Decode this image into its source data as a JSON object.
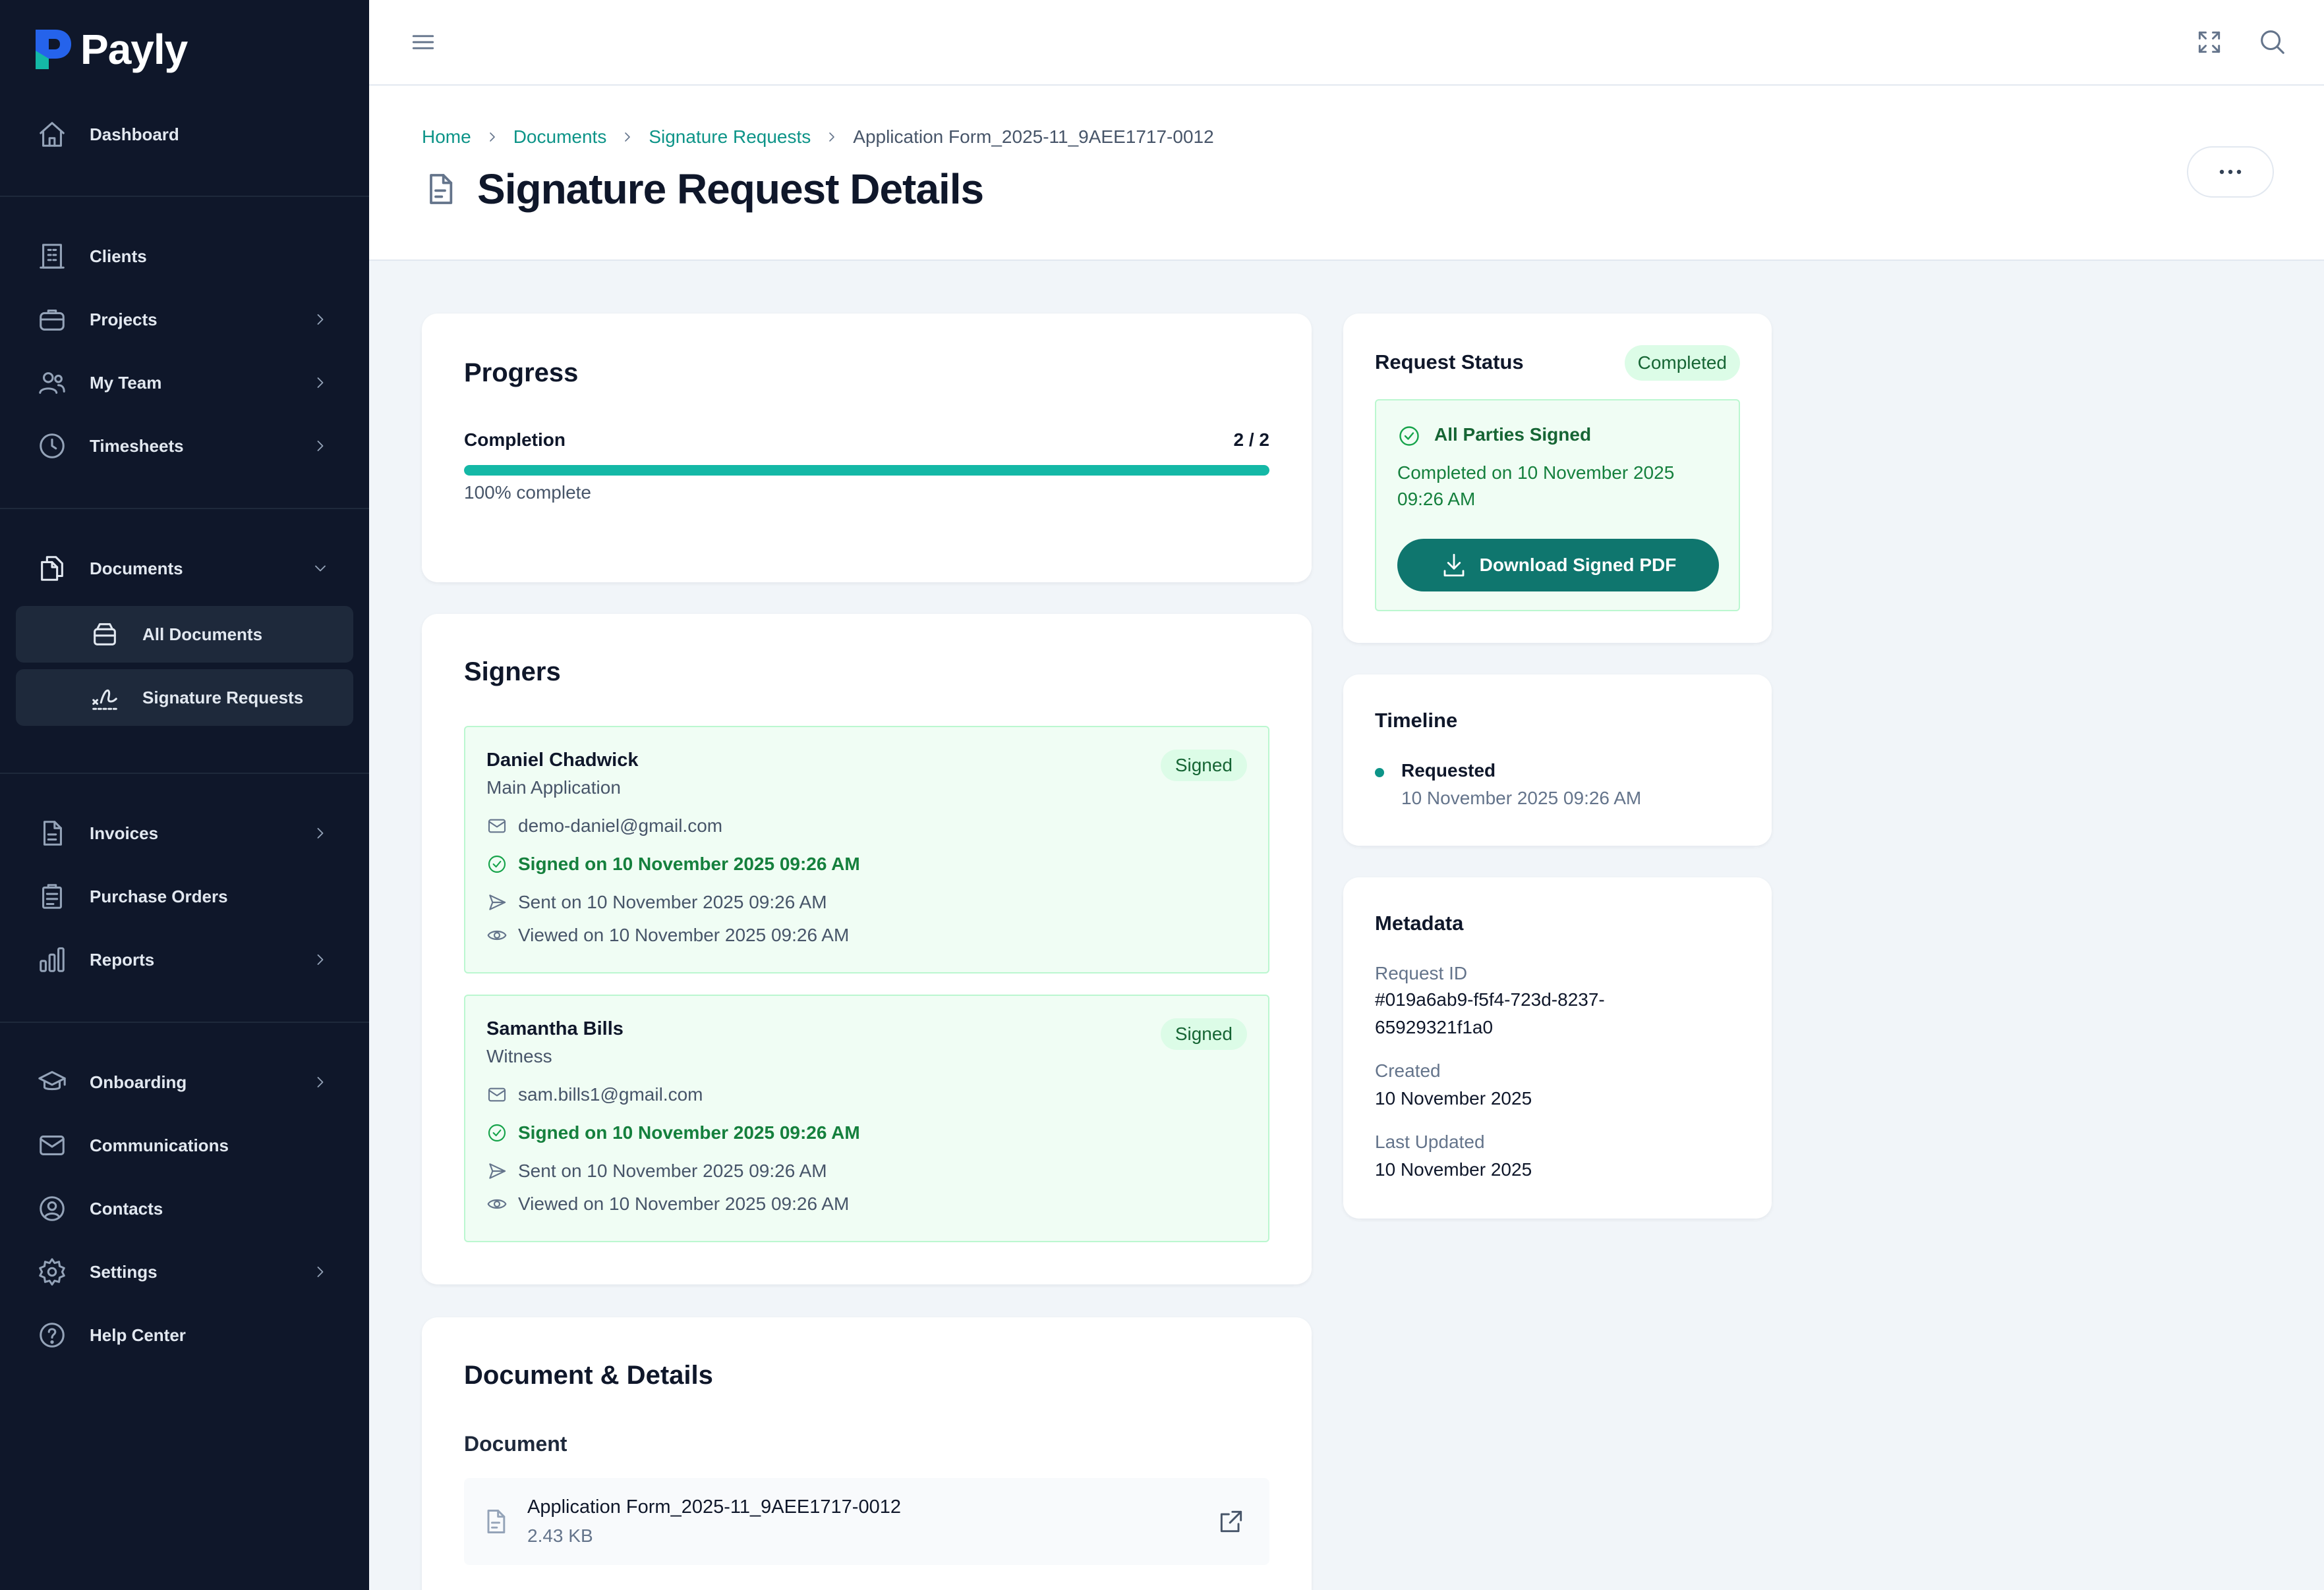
{
  "app": {
    "name": "Payly"
  },
  "sidebar": {
    "dashboard": "Dashboard",
    "clients": "Clients",
    "projects": "Projects",
    "my_team": "My Team",
    "timesheets": "Timesheets",
    "documents": "Documents",
    "all_documents": "All Documents",
    "signature_requests": "Signature Requests",
    "invoices": "Invoices",
    "purchase_orders": "Purchase Orders",
    "reports": "Reports",
    "onboarding": "Onboarding",
    "communications": "Communications",
    "contacts": "Contacts",
    "settings": "Settings",
    "help_center": "Help Center"
  },
  "breadcrumb": {
    "home": "Home",
    "documents": "Documents",
    "signature_requests": "Signature Requests",
    "current": "Application Form_2025-11_9AEE1717-0012"
  },
  "page": {
    "title": "Signature Request Details"
  },
  "progress": {
    "title": "Progress",
    "label": "Completion",
    "count": "2 / 2",
    "percent": 100,
    "percent_text": "100% complete"
  },
  "signers": {
    "title": "Signers",
    "items": [
      {
        "name": "Daniel Chadwick",
        "role": "Main Application",
        "status": "Signed",
        "email": "demo-daniel@gmail.com",
        "signed": "Signed on 10 November 2025 09:26 AM",
        "sent": "Sent on 10 November 2025 09:26 AM",
        "viewed": "Viewed on 10 November 2025 09:26 AM"
      },
      {
        "name": "Samantha Bills",
        "role": "Witness",
        "status": "Signed",
        "email": "sam.bills1@gmail.com",
        "signed": "Signed on 10 November 2025 09:26 AM",
        "sent": "Sent on 10 November 2025 09:26 AM",
        "viewed": "Viewed on 10 November 2025 09:26 AM"
      }
    ]
  },
  "document": {
    "title": "Document & Details",
    "subtitle": "Document",
    "file_name": "Application Form_2025-11_9AEE1717-0012",
    "file_size": "2.43 KB"
  },
  "request_status": {
    "title": "Request Status",
    "badge": "Completed",
    "heading": "All Parties Signed",
    "completed_line1": "Completed on 10 November 2025",
    "completed_line2": "09:26 AM",
    "download_label": "Download Signed PDF"
  },
  "timeline": {
    "title": "Timeline",
    "events": [
      {
        "label": "Requested",
        "time": "10 November 2025 09:26 AM"
      }
    ]
  },
  "metadata": {
    "title": "Metadata",
    "request_id_label": "Request ID",
    "request_id_line1": "#019a6ab9-f5f4-723d-8237-",
    "request_id_line2": "65929321f1a0",
    "created_label": "Created",
    "created_value": "10 November 2025",
    "updated_label": "Last Updated",
    "updated_value": "10 November 2025"
  },
  "colors": {
    "sidebar_bg": "#0f172a",
    "accent": "#0d9488",
    "success_bg": "#f0fdf4",
    "success_text": "#15803d"
  }
}
